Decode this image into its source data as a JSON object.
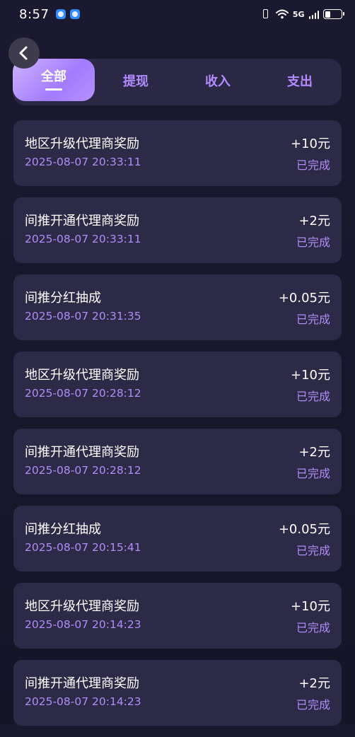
{
  "status_bar": {
    "time": "8:57",
    "network": "5G"
  },
  "tabs": [
    {
      "label": "全部",
      "active": true
    },
    {
      "label": "提现",
      "active": false
    },
    {
      "label": "收入",
      "active": false
    },
    {
      "label": "支出",
      "active": false
    }
  ],
  "transactions": [
    {
      "title": "地区升级代理商奖励",
      "time": "2025-08-07 20:33:11",
      "amount": "+10元",
      "status": "已完成"
    },
    {
      "title": "间推开通代理商奖励",
      "time": "2025-08-07 20:33:11",
      "amount": "+2元",
      "status": "已完成"
    },
    {
      "title": "间推分红抽成",
      "time": "2025-08-07 20:31:35",
      "amount": "+0.05元",
      "status": "已完成"
    },
    {
      "title": "地区升级代理商奖励",
      "time": "2025-08-07 20:28:12",
      "amount": "+10元",
      "status": "已完成"
    },
    {
      "title": "间推开通代理商奖励",
      "time": "2025-08-07 20:28:12",
      "amount": "+2元",
      "status": "已完成"
    },
    {
      "title": "间推分红抽成",
      "time": "2025-08-07 20:15:41",
      "amount": "+0.05元",
      "status": "已完成"
    },
    {
      "title": "地区升级代理商奖励",
      "time": "2025-08-07 20:14:23",
      "amount": "+10元",
      "status": "已完成"
    },
    {
      "title": "间推开通代理商奖励",
      "time": "2025-08-07 20:14:23",
      "amount": "+2元",
      "status": "已完成"
    }
  ],
  "icons": {
    "back": "chevron-left-icon"
  },
  "colors": {
    "accent": "#a37bff",
    "secondary_text": "#b08cf7",
    "card_bg": "#2c2a46",
    "page_bg": "#1b1930"
  }
}
